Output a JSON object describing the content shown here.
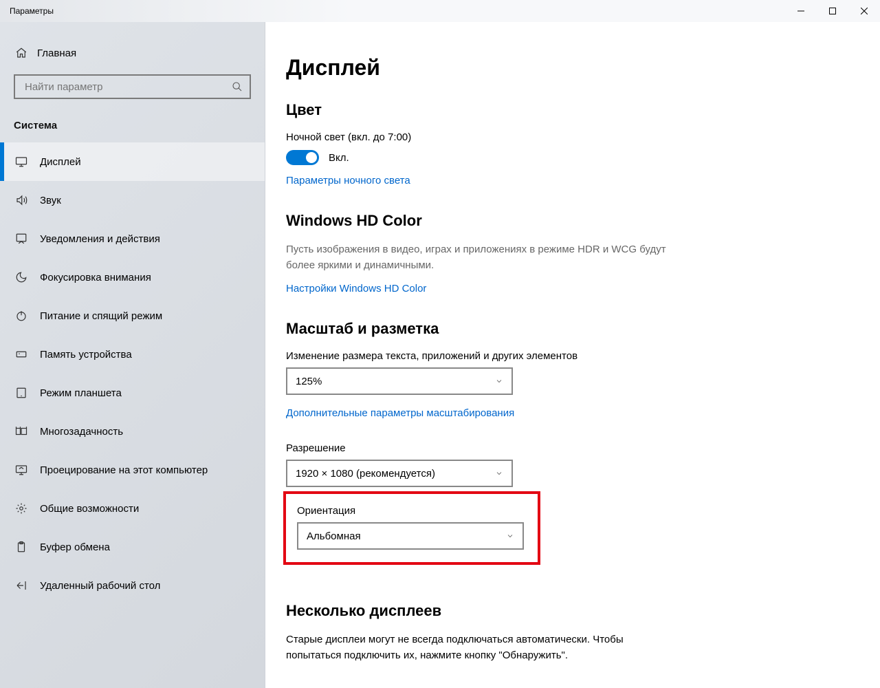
{
  "titlebar": {
    "title": "Параметры"
  },
  "home": {
    "label": "Главная"
  },
  "search": {
    "placeholder": "Найти параметр"
  },
  "category": "Система",
  "nav": [
    {
      "id": "display",
      "label": "Дисплей",
      "active": true
    },
    {
      "id": "sound",
      "label": "Звук",
      "active": false
    },
    {
      "id": "notifications",
      "label": "Уведомления и действия",
      "active": false
    },
    {
      "id": "focus",
      "label": "Фокусировка внимания",
      "active": false
    },
    {
      "id": "power",
      "label": "Питание и спящий режим",
      "active": false
    },
    {
      "id": "storage",
      "label": "Память устройства",
      "active": false
    },
    {
      "id": "tablet",
      "label": "Режим планшета",
      "active": false
    },
    {
      "id": "multitask",
      "label": "Многозадачность",
      "active": false
    },
    {
      "id": "project",
      "label": "Проецирование на этот компьютер",
      "active": false
    },
    {
      "id": "shared",
      "label": "Общие возможности",
      "active": false
    },
    {
      "id": "clipboard",
      "label": "Буфер обмена",
      "active": false
    },
    {
      "id": "remote",
      "label": "Удаленный рабочий стол",
      "active": false
    }
  ],
  "page": {
    "title": "Дисплей",
    "color": {
      "heading": "Цвет",
      "night_caption": "Ночной свет (вкл. до 7:00)",
      "toggle_state": "Вкл.",
      "link": "Параметры ночного света"
    },
    "hdr": {
      "heading": "Windows HD Color",
      "desc": "Пусть изображения в видео, играх и приложениях в режиме HDR и WCG будут более яркими и динамичными.",
      "link": "Настройки Windows HD Color"
    },
    "scale": {
      "heading": "Масштаб и разметка",
      "size_label": "Изменение размера текста, приложений и других элементов",
      "size_value": "125%",
      "adv_link": "Дополнительные параметры масштабирования",
      "res_label": "Разрешение",
      "res_value": "1920 × 1080 (рекомендуется)",
      "orient_label": "Ориентация",
      "orient_value": "Альбомная"
    },
    "multi": {
      "heading": "Несколько дисплеев",
      "desc": "Старые дисплеи могут не всегда подключаться автоматически. Чтобы попытаться подключить их, нажмите кнопку \"Обнаружить\"."
    }
  }
}
